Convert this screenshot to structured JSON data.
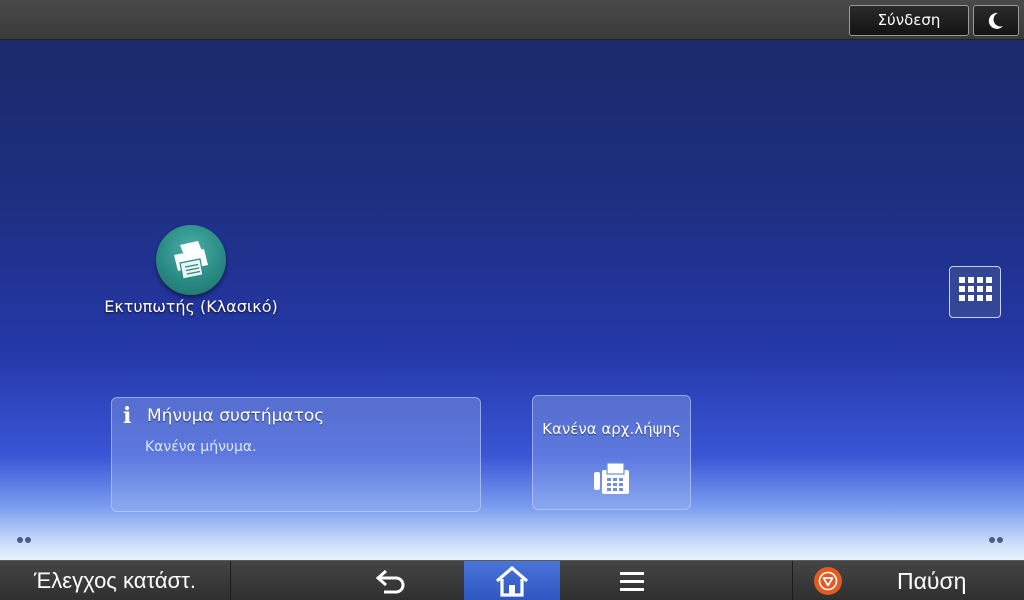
{
  "topbar": {
    "login_label": "Σύνδεση",
    "sleep_icon": "moon-icon"
  },
  "home": {
    "apps": [
      {
        "label": "Εκτυπωτής (Κλασικό)",
        "icon": "printer-icon",
        "color": "#2a8b84"
      }
    ],
    "app_list_icon": "grid-icon",
    "widgets": {
      "system_message": {
        "title": "Μήνυμα συστήματος",
        "body": "Κανένα μήνυμα.",
        "icon": "info-icon"
      },
      "fax": {
        "title": "Κανένα αρχ.λήψης",
        "icon": "fax-icon"
      }
    }
  },
  "bottombar": {
    "status_label": "Έλεγχος κατάστ.",
    "back_icon": "back-arrow-icon",
    "home_icon": "home-icon",
    "menu_icon": "menu-icon",
    "stop_icon": "stop-icon",
    "stop_color": "#e55a1e",
    "pause_label": "Παύση"
  }
}
